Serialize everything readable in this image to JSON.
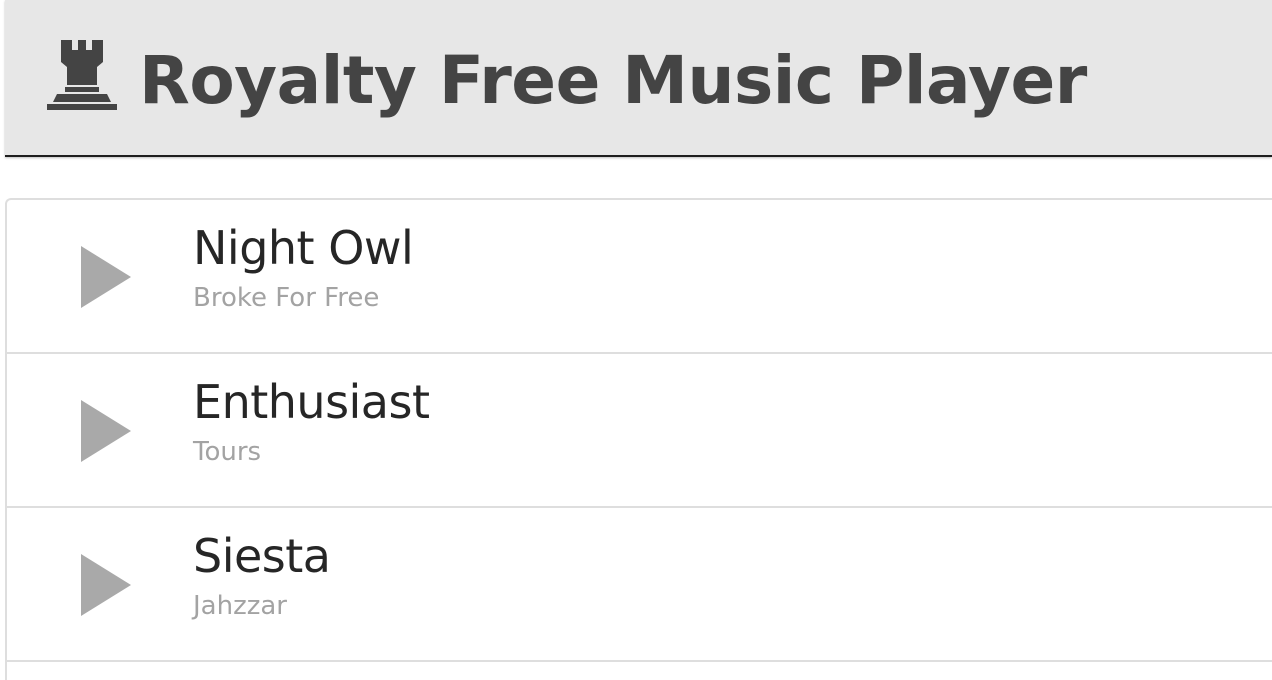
{
  "header": {
    "title": "Royalty Free Music Player",
    "logo_icon": "chess-rook-icon"
  },
  "playlist": {
    "play_icon": "play-triangle-icon",
    "colors": {
      "play_icon": "#a9a9a9",
      "title_text": "#262626",
      "artist_text": "#a3a3a3",
      "header_bg": "#e7e7e7",
      "header_text": "#444444"
    },
    "tracks": [
      {
        "title": "Night Owl",
        "artist": "Broke For Free"
      },
      {
        "title": "Enthusiast",
        "artist": "Tours"
      },
      {
        "title": "Siesta",
        "artist": "Jahzzar"
      }
    ]
  }
}
